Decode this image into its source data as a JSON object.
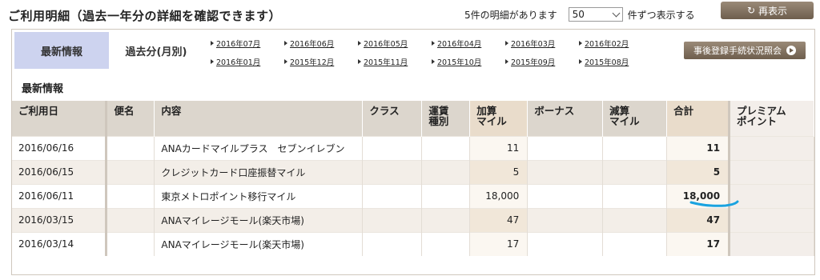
{
  "header": {
    "title": "ご利用明細（過去一年分の詳細を確認できます）",
    "count_text": "5件の明細があります",
    "per_page_value": "50",
    "per_page_suffix": "件ずつ表示する",
    "refresh_label": "再表示"
  },
  "nav": {
    "tab_latest": "最新情報",
    "tab_past": "過去分(月別)",
    "months": [
      "2016年07月",
      "2016年06月",
      "2016年05月",
      "2016年04月",
      "2016年03月",
      "2016年02月",
      "2016年01月",
      "2015年12月",
      "2015年11月",
      "2015年10月",
      "2015年09月",
      "2015年08月"
    ],
    "registration_button": "事後登録手続状況照会"
  },
  "section_label": "最新情報",
  "table": {
    "headers": {
      "date": "ご利用日",
      "flight": "便名",
      "content": "内容",
      "class": "クラス",
      "fare_l1": "運賃",
      "fare_l2": "種別",
      "added_l1": "加算",
      "added_l2": "マイル",
      "bonus": "ボーナス",
      "deducted_l1": "減算",
      "deducted_l2": "マイル",
      "total": "合計",
      "premium_l1": "プレミアム",
      "premium_l2": "ポイント"
    },
    "rows": [
      {
        "date": "2016/06/16",
        "flight": "",
        "content": "ANAカードマイルプラス　セブンイレブン",
        "class": "",
        "fare": "",
        "added": "11",
        "bonus": "",
        "deducted": "",
        "total": "11",
        "premium": ""
      },
      {
        "date": "2016/06/15",
        "flight": "",
        "content": "クレジットカード口座振替マイル",
        "class": "",
        "fare": "",
        "added": "5",
        "bonus": "",
        "deducted": "",
        "total": "5",
        "premium": ""
      },
      {
        "date": "2016/06/11",
        "flight": "",
        "content": "東京メトロポイント移行マイル",
        "class": "",
        "fare": "",
        "added": "18,000",
        "bonus": "",
        "deducted": "",
        "total": "18,000",
        "premium": ""
      },
      {
        "date": "2016/03/15",
        "flight": "",
        "content": "ANAマイレージモール(楽天市場)",
        "class": "",
        "fare": "",
        "added": "47",
        "bonus": "",
        "deducted": "",
        "total": "47",
        "premium": ""
      },
      {
        "date": "2016/03/14",
        "flight": "",
        "content": "ANAマイレージモール(楽天市場)",
        "class": "",
        "fare": "",
        "added": "17",
        "bonus": "",
        "deducted": "",
        "total": "17",
        "premium": ""
      }
    ]
  },
  "colors": {
    "accent_tab": "#cdd3ef",
    "button_brown": "#7a6a58",
    "annotation_underline": "#1aa3e0"
  }
}
